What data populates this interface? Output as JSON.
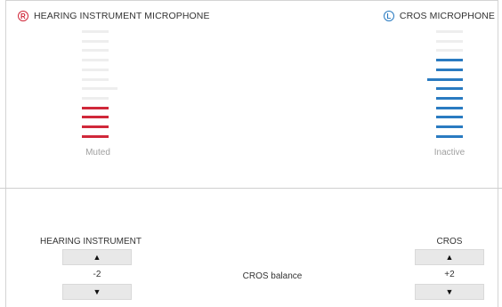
{
  "left_mic": {
    "badge": "R",
    "title": "HEARING INSTRUMENT MICROPHONE",
    "status": "Muted",
    "color": "#d0283a",
    "level_segments_active": 4,
    "total_segments": 12
  },
  "right_mic": {
    "badge": "L",
    "title": "CROS MICROPHONE",
    "status": "Inactive",
    "color": "#2a7bc1",
    "level_segments_active": 9,
    "total_segments": 12
  },
  "balance": {
    "label": "CROS balance",
    "left": {
      "label": "HEARING INSTRUMENT",
      "value": "-2",
      "up_icon": "up-arrow-icon",
      "down_icon": "down-arrow-icon"
    },
    "right": {
      "label": "CROS",
      "value": "+2",
      "up_icon": "up-arrow-icon",
      "down_icon": "down-arrow-icon"
    }
  }
}
